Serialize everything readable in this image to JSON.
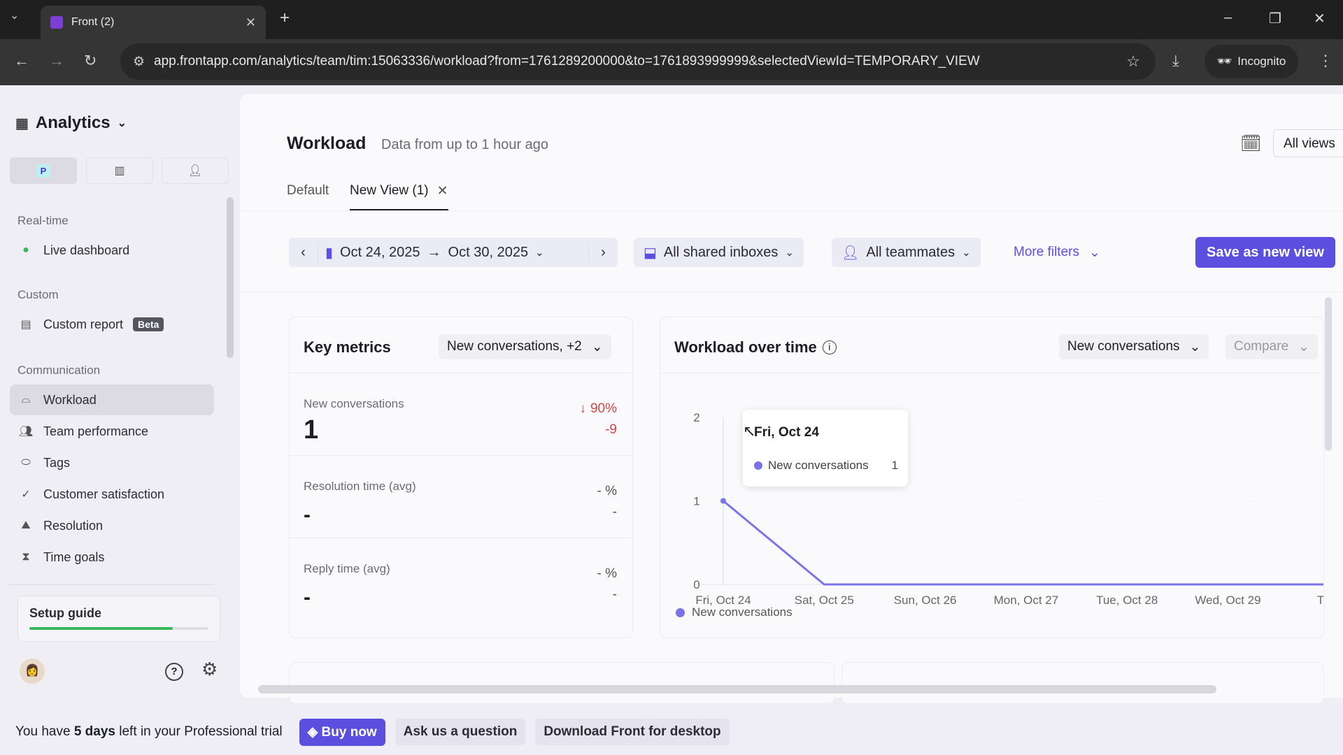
{
  "browser": {
    "tab_title": "Front (2)",
    "url": "app.frontapp.com/analytics/team/tim:15063336/workload?from=1761289200000&to=1761893999999&selectedViewId=TEMPORARY_VIEW",
    "incognito": "Incognito"
  },
  "sidebar": {
    "title": "Analytics",
    "workspace_badge": "P",
    "sections": [
      {
        "label": "Real-time"
      },
      {
        "label": "Custom"
      },
      {
        "label": "Communication"
      }
    ],
    "items": [
      {
        "label": "Live dashboard"
      },
      {
        "label": "Custom report",
        "badge": "Beta"
      },
      {
        "label": "Workload"
      },
      {
        "label": "Team performance"
      },
      {
        "label": "Tags"
      },
      {
        "label": "Customer satisfaction"
      },
      {
        "label": "Resolution"
      },
      {
        "label": "Time goals"
      }
    ],
    "setup_guide": {
      "label": "Setup guide",
      "progress": 0.8
    }
  },
  "header": {
    "title": "Workload",
    "subtitle": "Data from up to 1 hour ago",
    "all_views": "All views",
    "tabs": [
      {
        "label": "Default"
      },
      {
        "label": "New View (1)"
      }
    ]
  },
  "filters": {
    "date_from": "Oct 24, 2025",
    "arrow": "→",
    "date_to": "Oct 30, 2025",
    "inboxes": "All shared inboxes",
    "teammates": "All teammates",
    "more": "More filters",
    "save": "Save as new view"
  },
  "key_metrics": {
    "title": "Key metrics",
    "selector": "New conversations, +2",
    "metrics": [
      {
        "label": "New conversations",
        "value": "1",
        "change": "90%",
        "delta": "-9"
      },
      {
        "label": "Resolution time (avg)",
        "value": "-",
        "change": "- %",
        "delta": "-"
      },
      {
        "label": "Reply time (avg)",
        "value": "-",
        "change": "- %",
        "delta": "-"
      }
    ]
  },
  "workload_chart": {
    "title": "Workload over time",
    "metric_select": "New conversations",
    "compare": "Compare",
    "tooltip": {
      "date": "Fri, Oct 24",
      "series": "New conversations",
      "value": "1"
    }
  },
  "chart_data": {
    "type": "line",
    "categories": [
      "Fri, Oct 24",
      "Sat, Oct 25",
      "Sun, Oct 26",
      "Mon, Oct 27",
      "Tue, Oct 28",
      "Wed, Oct 29",
      "Thu,"
    ],
    "series": [
      {
        "name": "New conversations",
        "values": [
          1,
          0,
          0,
          0,
          0,
          0,
          0
        ],
        "color": "#7b74e6"
      }
    ],
    "yticks": [
      "0",
      "1",
      "2"
    ],
    "ylim": [
      0,
      2
    ],
    "legend": "bottom-left"
  },
  "banner": {
    "pre": "You have ",
    "days": "5 days",
    "post": " left in your Professional trial",
    "buy": "Buy now",
    "ask": "Ask us a question",
    "download": "Download Front for desktop"
  },
  "colors": {
    "accent": "#5b4fe0",
    "green": "#3cb85a",
    "down": "#d64545"
  }
}
